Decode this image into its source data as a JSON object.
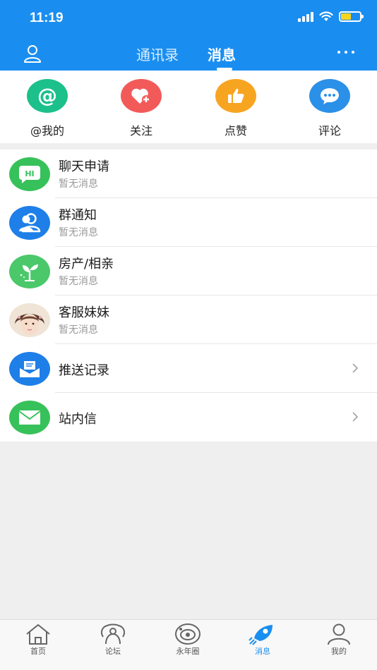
{
  "status_bar": {
    "time": "11:19"
  },
  "nav": {
    "tabs": [
      {
        "label": "通讯录",
        "active": false
      },
      {
        "label": "消息",
        "active": true
      }
    ]
  },
  "quick_actions": [
    {
      "label": "@我的",
      "icon": "at-icon",
      "color": "#1cc08a"
    },
    {
      "label": "关注",
      "icon": "heart-plus-icon",
      "color": "#f25a5a"
    },
    {
      "label": "点赞",
      "icon": "thumbs-up-icon",
      "color": "#f7a521"
    },
    {
      "label": "评论",
      "icon": "comment-bubble-icon",
      "color": "#2b90e8"
    }
  ],
  "messages": [
    {
      "title": "聊天申请",
      "subtitle": "暂无消息",
      "icon": "chat-hi-icon",
      "color": "#37c15a"
    },
    {
      "title": "群通知",
      "subtitle": "暂无消息",
      "icon": "group-icon",
      "color": "#1e7fe8"
    },
    {
      "title": "房产/相亲",
      "subtitle": "暂无消息",
      "icon": "sprout-icon",
      "color": "#4bc86a"
    },
    {
      "title": "客服妹妹",
      "subtitle": "暂无消息",
      "icon": "service-avatar",
      "color": "#e8d8c8"
    },
    {
      "title": "推送记录",
      "icon": "push-record-icon",
      "color": "#1e7fe8"
    },
    {
      "title": "站内信",
      "icon": "envelope-icon",
      "color": "#37c15a"
    }
  ],
  "tabbar": [
    {
      "label": "首页",
      "icon": "home-icon"
    },
    {
      "label": "论坛",
      "icon": "forum-icon"
    },
    {
      "label": "永年圈",
      "icon": "circle-icon"
    },
    {
      "label": "消息",
      "icon": "rocket-icon",
      "active": true
    },
    {
      "label": "我的",
      "icon": "profile-icon"
    }
  ]
}
